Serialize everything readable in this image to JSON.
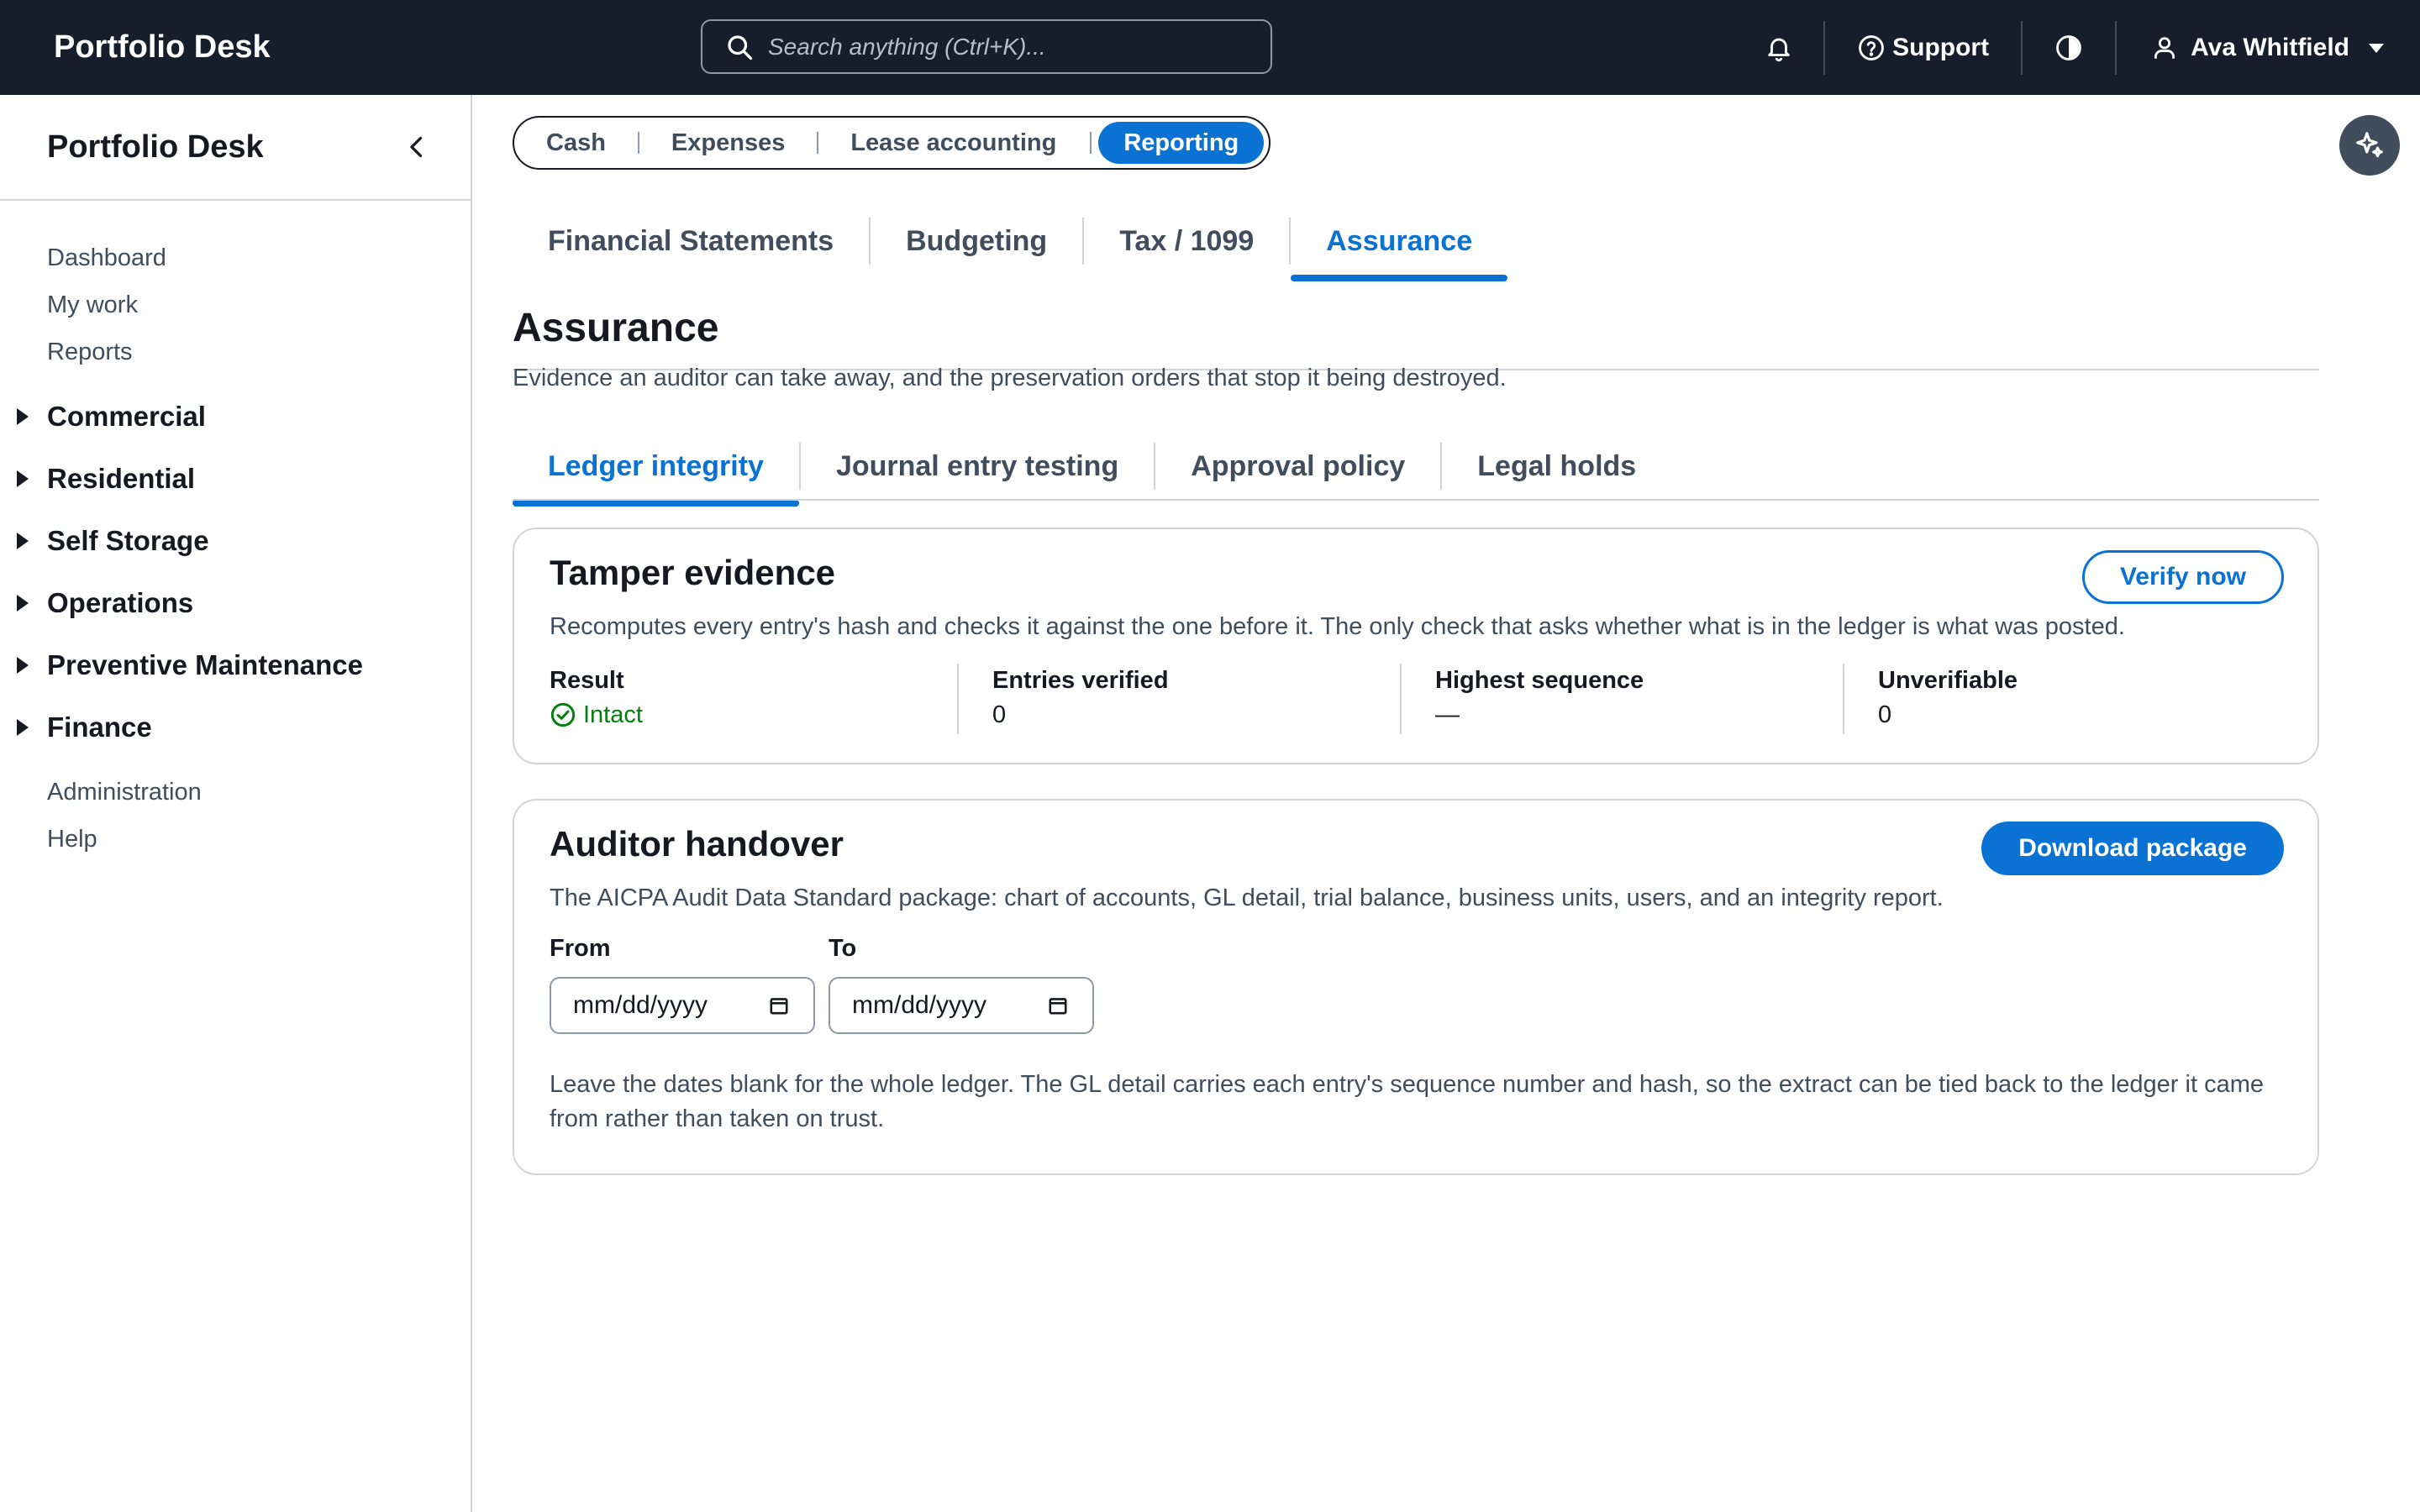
{
  "topbar": {
    "brand": "Portfolio Desk",
    "search_placeholder": "Search anything (Ctrl+K)...",
    "support_label": "Support",
    "user_name": "Ava Whitfield"
  },
  "sidebar": {
    "title": "Portfolio Desk",
    "top_links": [
      "Dashboard",
      "My work",
      "Reports"
    ],
    "groups": [
      "Commercial",
      "Residential",
      "Self Storage",
      "Operations",
      "Preventive Maintenance",
      "Finance"
    ],
    "bottom_links": [
      "Administration",
      "Help"
    ]
  },
  "segments": {
    "items": [
      "Cash",
      "Expenses",
      "Lease accounting",
      "Reporting"
    ],
    "active": "Reporting"
  },
  "tabs_primary": {
    "items": [
      "Financial Statements",
      "Budgeting",
      "Tax / 1099",
      "Assurance"
    ],
    "active": "Assurance"
  },
  "page": {
    "title": "Assurance",
    "description": "Evidence an auditor can take away, and the preservation orders that stop it being destroyed."
  },
  "tabs_secondary": {
    "items": [
      "Ledger integrity",
      "Journal entry testing",
      "Approval policy",
      "Legal holds"
    ],
    "active": "Ledger integrity"
  },
  "tamper": {
    "title": "Tamper evidence",
    "description": "Recomputes every entry's hash and checks it against the one before it. The only check that asks whether what is in the ledger is what was posted.",
    "button": "Verify now",
    "result_label": "Result",
    "result_value": "Intact",
    "entries_label": "Entries verified",
    "entries_value": "0",
    "highest_label": "Highest sequence",
    "highest_value": "—",
    "unverifiable_label": "Unverifiable",
    "unverifiable_value": "0",
    "status_color": "#037f0c"
  },
  "handover": {
    "title": "Auditor handover",
    "description": "The AICPA Audit Data Standard package: chart of accounts, GL detail, trial balance, business units, users, and an integrity report.",
    "button": "Download package",
    "from_label": "From",
    "to_label": "To",
    "from_placeholder": "mm/dd/yyyy",
    "to_placeholder": "mm/dd/yyyy",
    "note": "Leave the dates blank for the whole ledger. The GL detail carries each entry's sequence number and hash, so the extract can be tied back to the ledger it came from rather than taken on trust."
  },
  "colors": {
    "topbar": "#161d2b",
    "accent": "#0972d3",
    "success": "#037f0c"
  }
}
